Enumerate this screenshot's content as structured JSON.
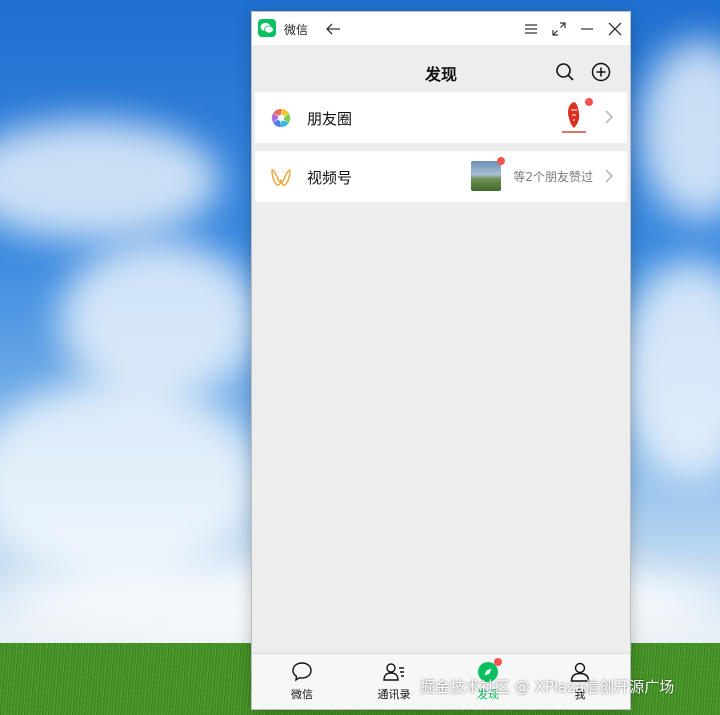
{
  "window": {
    "app_name": "微信"
  },
  "header": {
    "title": "发现"
  },
  "rows": {
    "moments_label": "朋友圈",
    "channels_label": "视频号",
    "channels_sub": "等2个朋友赞过"
  },
  "tabs": {
    "chats": "微信",
    "contacts": "通讯录",
    "discover": "发现",
    "me": "我"
  },
  "watermark": "掘金技术社区 @ XPlaza信创开源广场",
  "colors": {
    "brand_green": "#07c160",
    "badge_red": "#fa5151",
    "background": "#ededed"
  },
  "icons": [
    "wechat-logo-icon",
    "back-arrow-icon",
    "menu-icon",
    "maximize-icon",
    "minimize-icon",
    "close-icon",
    "search-icon",
    "add-icon",
    "moments-icon",
    "channels-icon",
    "chevron-right-icon",
    "chat-icon",
    "contacts-icon",
    "discover-icon",
    "me-icon"
  ]
}
